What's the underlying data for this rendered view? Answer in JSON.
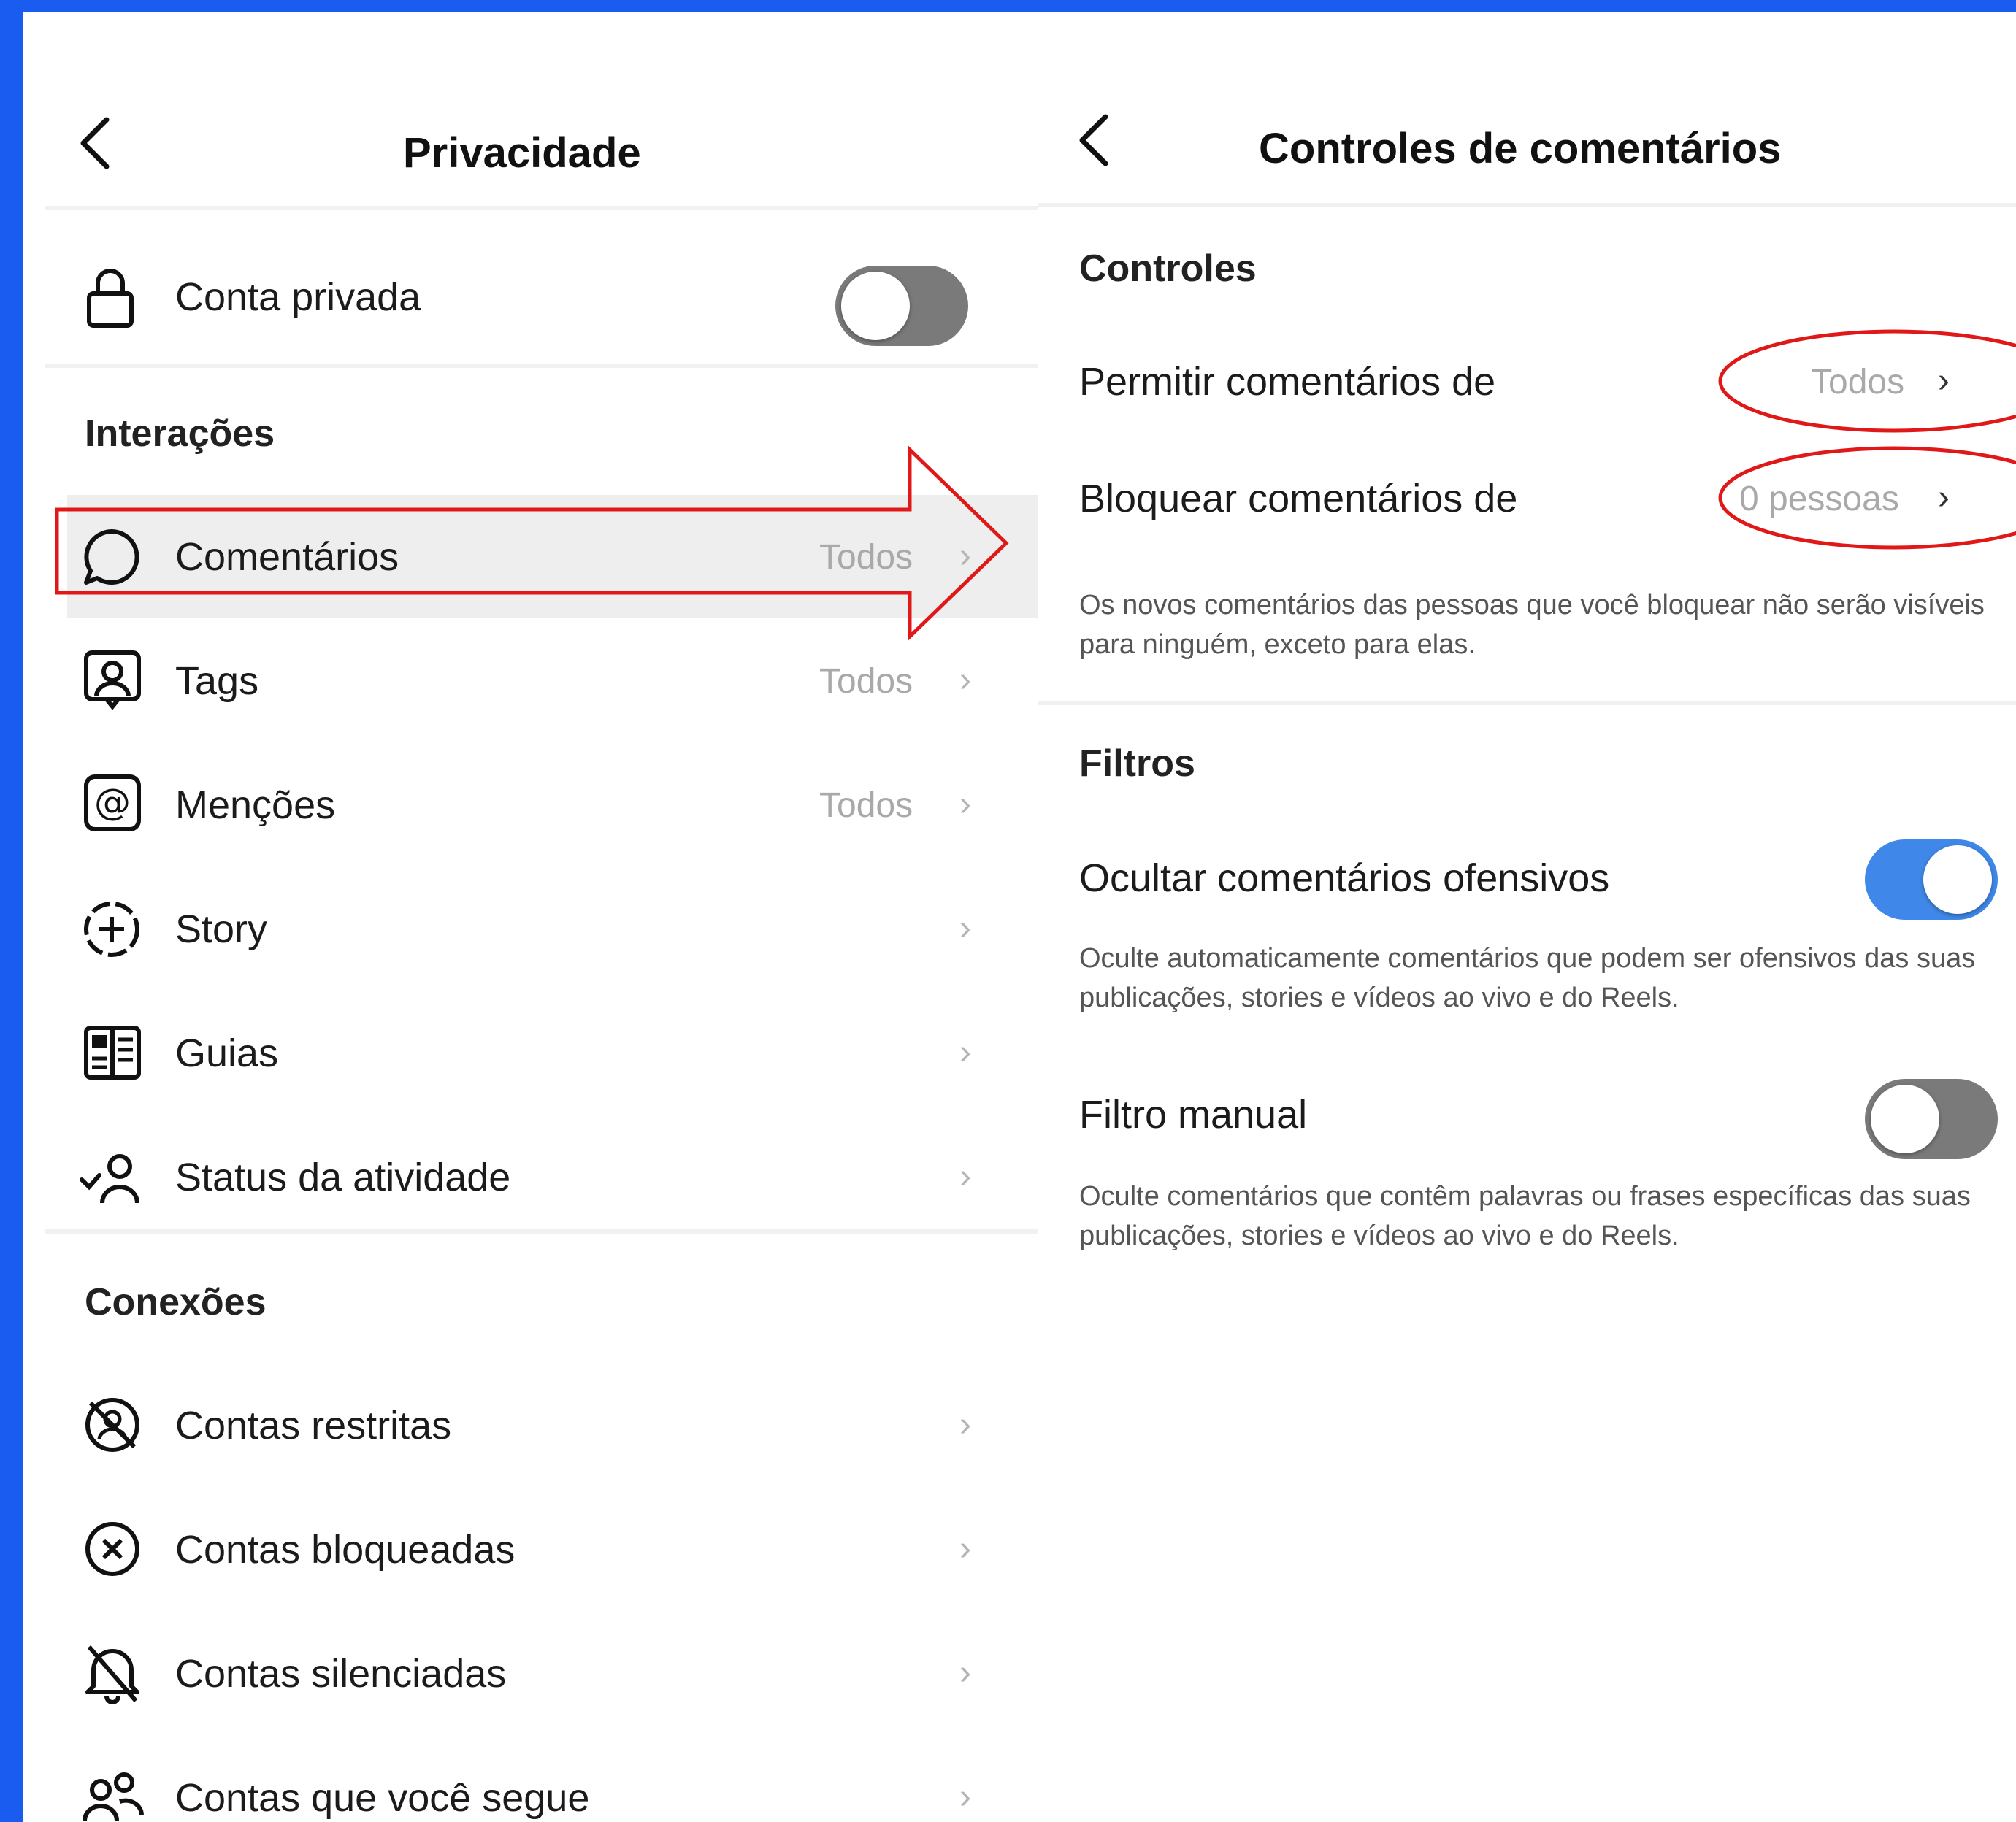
{
  "left": {
    "title": "Privacidade",
    "private_account": {
      "label": "Conta privada",
      "toggle": "off"
    },
    "section_interactions": "Interações",
    "interactions": [
      {
        "label": "Comentários",
        "value": "Todos",
        "icon": "comment-bubble-icon"
      },
      {
        "label": "Tags",
        "value": "Todos",
        "icon": "tag-person-icon"
      },
      {
        "label": "Menções",
        "value": "Todos",
        "icon": "mention-icon"
      },
      {
        "label": "Story",
        "value": "",
        "icon": "story-add-icon"
      },
      {
        "label": "Guias",
        "value": "",
        "icon": "guides-icon"
      },
      {
        "label": "Status da atividade",
        "value": "",
        "icon": "activity-status-icon"
      }
    ],
    "section_connections": "Conexões",
    "connections": [
      {
        "label": "Contas restritas",
        "icon": "restricted-icon"
      },
      {
        "label": "Contas bloqueadas",
        "icon": "blocked-icon"
      },
      {
        "label": "Contas silenciadas",
        "icon": "muted-bell-icon"
      },
      {
        "label": "Contas que você segue",
        "icon": "following-icon"
      }
    ]
  },
  "right": {
    "title": "Controles de comentários",
    "section_controls": "Controles",
    "allow_label": "Permitir comentários de",
    "allow_value": "Todos",
    "block_label": "Bloquear comentários de",
    "block_value": "0 pessoas",
    "block_desc": "Os novos comentários das pessoas que você bloquear não serão visíveis para ninguém, exceto para elas.",
    "section_filters": "Filtros",
    "hide_label": "Ocultar comentários ofensivos",
    "hide_desc": "Oculte automaticamente comentários que podem ser ofensivos das suas publicações, stories e vídeos ao vivo e do Reels.",
    "hide_toggle": "on",
    "manual_label": "Filtro manual",
    "manual_desc": "Oculte comentários que contêm palavras ou frases específicas das suas publicações, stories e vídeos ao vivo e do Reels.",
    "manual_toggle": "off"
  },
  "colors": {
    "frame_border": "#1a5cf0",
    "annotation_red": "#e01818",
    "toggle_on": "#3f88e9",
    "toggle_off": "#7a7a7a"
  }
}
